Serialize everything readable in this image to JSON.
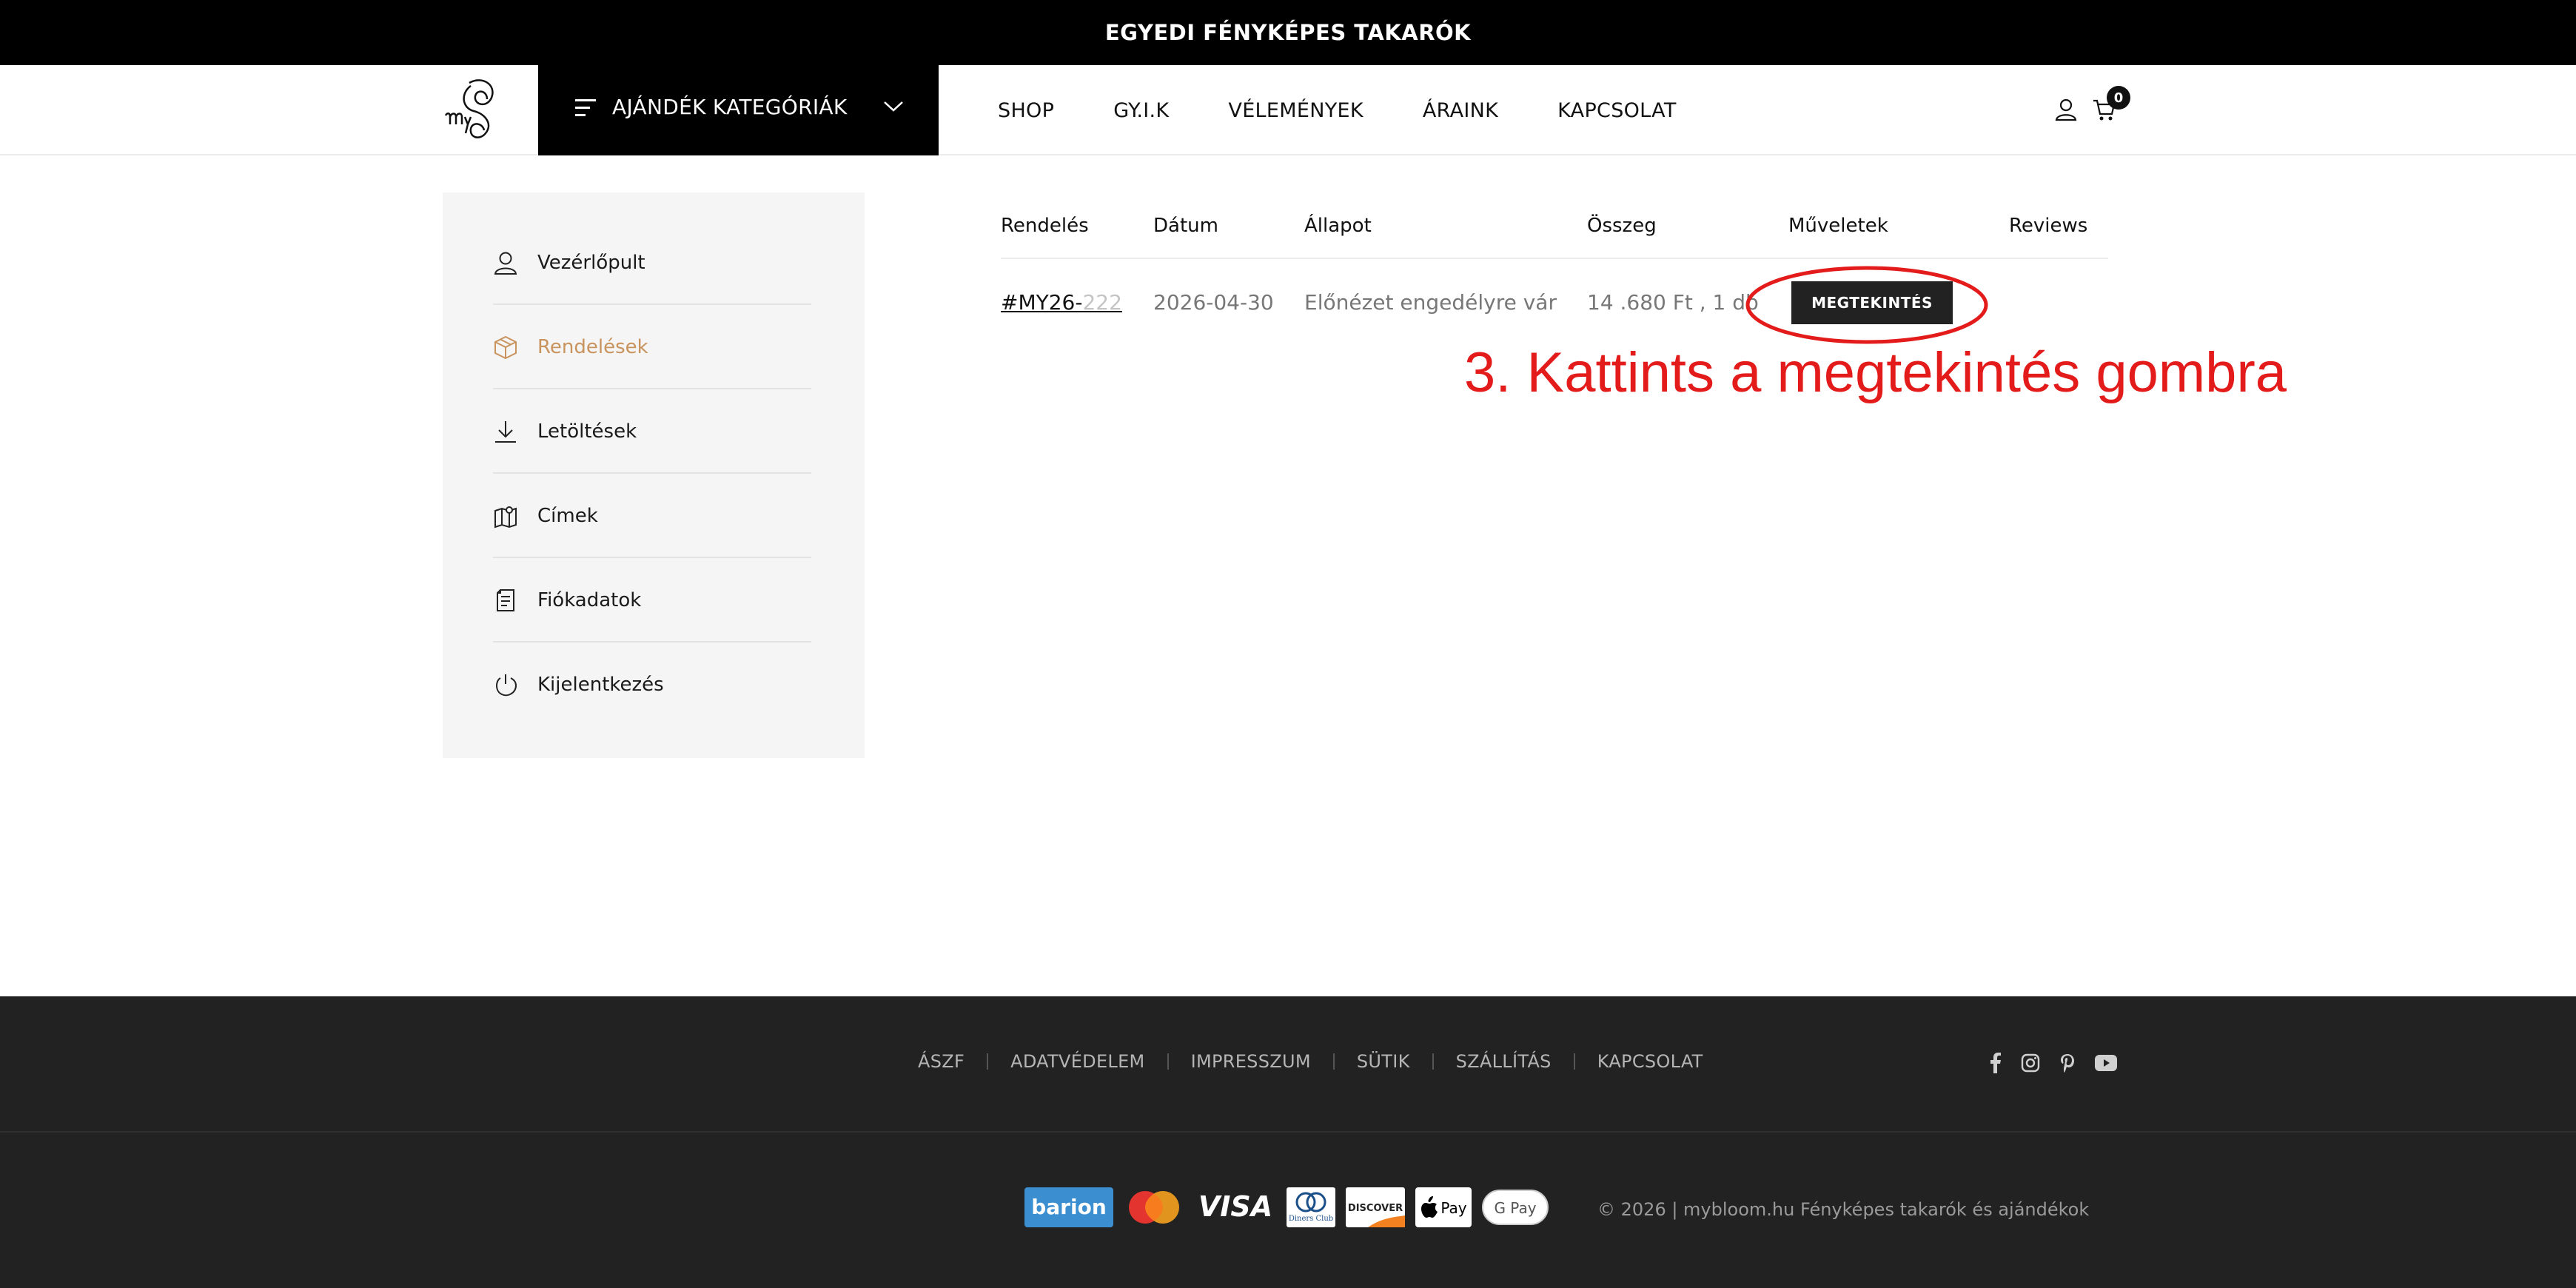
{
  "announcement": "EGYEDI FÉNYKÉPES TAKARÓK",
  "header": {
    "category_label": "AJÁNDÉK KATEGÓRIÁK",
    "nav": [
      "SHOP",
      "GY.I.K",
      "VÉLEMÉNYEK",
      "ÁRAINK",
      "KAPCSOLAT"
    ],
    "cart_count": "0"
  },
  "sidebar": {
    "items": [
      {
        "label": "Vezérlőpult",
        "icon": "user-icon"
      },
      {
        "label": "Rendelések",
        "icon": "box-icon",
        "active": true
      },
      {
        "label": "Letöltések",
        "icon": "download-icon"
      },
      {
        "label": "Címek",
        "icon": "map-icon"
      },
      {
        "label": "Fiókadatok",
        "icon": "document-icon"
      },
      {
        "label": "Kijelentkezés",
        "icon": "power-icon"
      }
    ]
  },
  "orders": {
    "headers": [
      "Rendelés",
      "Dátum",
      "Állapot",
      "Összeg",
      "Műveletek",
      "Reviews"
    ],
    "rows": [
      {
        "order_prefix": "#MY26-",
        "order_suffix": "222",
        "date": "2026-04-30",
        "status": "Előnézet engedélyre vár",
        "total": "14 .680 Ft , 1 db",
        "action": "MEGTEKINTÉS"
      }
    ]
  },
  "annotation": "3. Kattints a megtekintés gombra",
  "footer": {
    "links": [
      "ÁSZF",
      "ADATVÉDELEM",
      "IMPRESSZUM",
      "SÜTIK",
      "SZÁLLÍTÁS",
      "KAPCSOLAT"
    ],
    "social": [
      "facebook-icon",
      "instagram-icon",
      "pinterest-icon",
      "youtube-icon"
    ],
    "payments": {
      "barion": "barion",
      "visa": "VISA",
      "diners": "Diners Club",
      "discover": "DISCOVER",
      "applepay": "Pay",
      "googlepay": "G Pay"
    },
    "copyright": "© 2026 | mybloom.hu Fényképes takarók és ajándékok"
  },
  "colors": {
    "accent": "#c9935e",
    "annotation": "#e31b1b",
    "footer_bg": "#222222"
  }
}
